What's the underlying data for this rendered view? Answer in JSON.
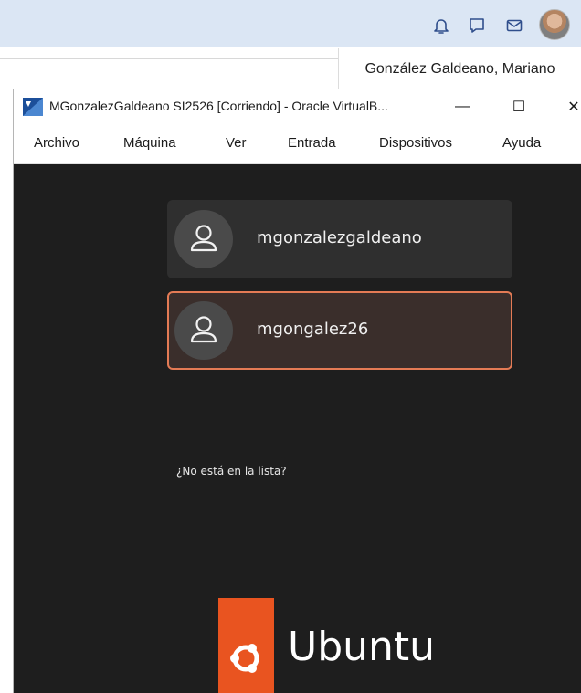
{
  "host": {
    "icons": [
      "bell-icon",
      "chat-icon",
      "mail-icon"
    ],
    "user_name": "González Galdeano, Mariano"
  },
  "vbox": {
    "title": "MGonzalezGaldeano SI2526 [Corriendo] - Oracle VirtualB...",
    "controls": {
      "minimize": "—",
      "maximize": "☐",
      "close": "✕"
    },
    "menu": [
      "Archivo",
      "Máquina",
      "Ver",
      "Entrada",
      "Dispositivos",
      "Ayuda"
    ]
  },
  "login": {
    "users": [
      {
        "name": "mgonzalezgaldeano",
        "selected": false
      },
      {
        "name": "mgongalez26",
        "selected": true
      }
    ],
    "not_listed": "¿No está en la lista?",
    "brand": "Ubuntu"
  },
  "colors": {
    "accent": "#e95420",
    "selection_border": "#e47b55",
    "host_bar": "#dbe6f4"
  }
}
